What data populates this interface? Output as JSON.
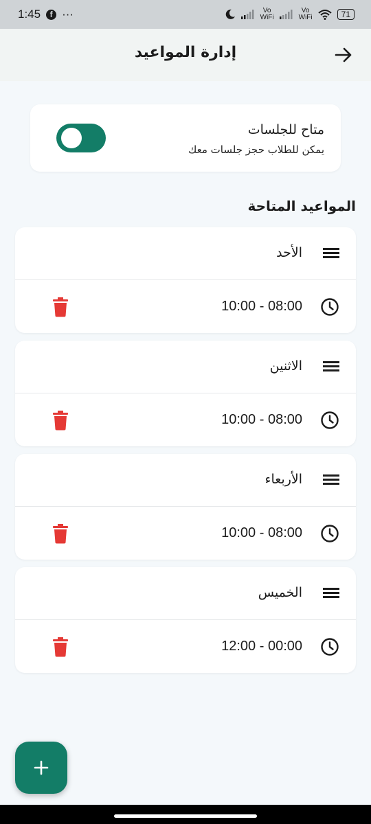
{
  "status_bar": {
    "time": "1:45",
    "dots": "···",
    "vo_wifi": "Vo\nWiFi",
    "battery": "71"
  },
  "header": {
    "title": "إدارة المواعيد"
  },
  "availability": {
    "title": "متاح للجلسات",
    "subtitle": "يمكن للطلاب حجز جلسات معك",
    "enabled": true
  },
  "section": {
    "title": "المواعيد المتاحة"
  },
  "days": [
    {
      "name": "الأحد",
      "time": "10:00 - 08:00"
    },
    {
      "name": "الاثنين",
      "time": "10:00 - 08:00"
    },
    {
      "name": "الأربعاء",
      "time": "10:00 - 08:00"
    },
    {
      "name": "الخميس",
      "time": "12:00 - 00:00"
    }
  ],
  "colors": {
    "primary": "#137d67",
    "delete": "#e53935",
    "background": "#f4f8fb"
  },
  "icons": {
    "back": "arrow-right-icon",
    "drag": "drag-handle-icon",
    "clock": "clock-icon",
    "delete": "trash-icon",
    "add": "plus-icon"
  }
}
